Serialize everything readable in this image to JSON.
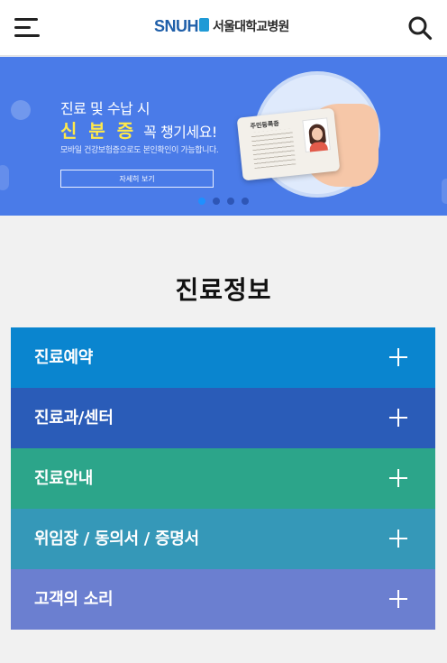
{
  "header": {
    "logo_snuh": "SNUH",
    "logo_name": "서울대학교병원",
    "menu_icon": "hamburger-menu-icon",
    "search_icon": "search-icon"
  },
  "banner": {
    "line1": "진료 및 수납 시",
    "highlight": "신 분 증",
    "line2_tail": "꼭 챙기세요!",
    "line3": "모바일 건강보험증으로도 본인확인이 가능합니다.",
    "button_label": "자세히 보기",
    "card_title": "주민등록증",
    "pager_count": 4,
    "pager_active": 1,
    "colors": {
      "background": "#4a7be8",
      "highlight": "#ffe94a"
    }
  },
  "section": {
    "title": "진료정보"
  },
  "accordion": [
    {
      "label": "진료예약",
      "color": "#0a85cf"
    },
    {
      "label": "진료과/센터",
      "color": "#2a5cb8"
    },
    {
      "label": "진료안내",
      "color": "#2ca58a"
    },
    {
      "label": "위임장 / 동의서 / 증명서",
      "color": "#3598b8"
    },
    {
      "label": "고객의 소리",
      "color": "#6b7fd0"
    }
  ]
}
